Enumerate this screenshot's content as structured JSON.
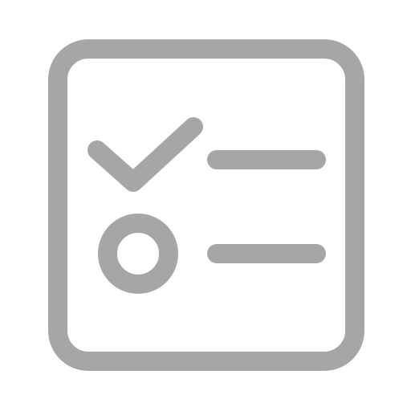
{
  "icon": {
    "name": "task-list-icon",
    "color": "#a6a6a6",
    "background": "#ffffff",
    "items": [
      {
        "kind": "checked",
        "marker_icon": "checkmark-icon",
        "line_icon": "text-line-icon"
      },
      {
        "kind": "unchecked",
        "marker_icon": "circle-icon",
        "line_icon": "text-line-icon"
      }
    ]
  }
}
